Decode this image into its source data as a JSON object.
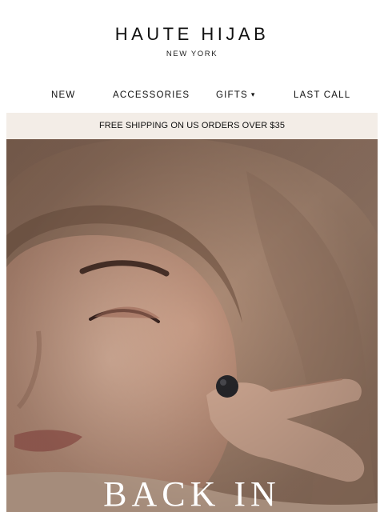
{
  "header": {
    "brand": "HAUTE HIJAB",
    "brand_sub": "NEW YORK"
  },
  "nav": {
    "items": [
      {
        "label": "NEW"
      },
      {
        "label": "ACCESSORIES"
      },
      {
        "label": "GIFTS"
      },
      {
        "label": "LAST CALL"
      }
    ],
    "gifts_icon": "chevron-down-icon"
  },
  "banner": {
    "text": "FREE SHIPPING ON US ORDERS OVER $35"
  },
  "hero": {
    "headline": "BACK IN",
    "colors": {
      "scarf": "#a88671",
      "skin": "#c9a08a",
      "accent_dark": "#2a2a2e"
    }
  }
}
